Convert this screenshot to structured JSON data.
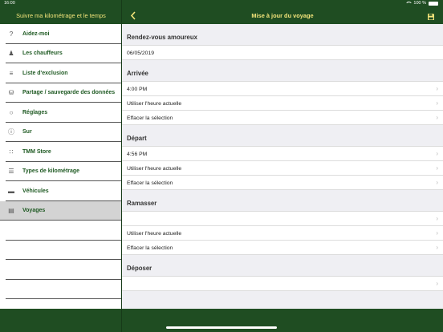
{
  "status": {
    "time": "16:00",
    "battery": "100 %",
    "battery_badge": ""
  },
  "sidebar": {
    "title": "Suivre ma kilométrage et le temps",
    "items": [
      {
        "label": "Aidez-moi",
        "icon": "?"
      },
      {
        "label": "Les chauffeurs",
        "icon": "♟"
      },
      {
        "label": "Liste d'exclusion",
        "icon": "≡"
      },
      {
        "label": "Partage / sauvegarde des données",
        "icon": "⛁"
      },
      {
        "label": "Réglages",
        "icon": "○"
      },
      {
        "label": "Sur",
        "icon": "ⓘ"
      },
      {
        "label": "TMM Store",
        "icon": "∷"
      },
      {
        "label": "Types de kilométrage",
        "icon": "☰"
      },
      {
        "label": "Véhicules",
        "icon": "▬"
      },
      {
        "label": "Voyages",
        "icon": "▤"
      }
    ],
    "active_index": 9
  },
  "header": {
    "title": "Mise à jour du voyage"
  },
  "sections": [
    {
      "title": "Rendez-vous amoureux",
      "rows": [
        {
          "text": "06/05/2019"
        }
      ]
    },
    {
      "title": "Arrivée",
      "rows": [
        {
          "text": "4:00 PM"
        },
        {
          "text": "Utiliser l'heure actuelle"
        },
        {
          "text": "Effacer la sélection"
        }
      ]
    },
    {
      "title": "Départ",
      "rows": [
        {
          "text": "4:56 PM"
        },
        {
          "text": "Utiliser l'heure actuelle"
        },
        {
          "text": "Effacer la sélection"
        }
      ]
    },
    {
      "title": "Ramasser",
      "rows": [
        {
          "text": ""
        },
        {
          "text": "Utiliser l'heure actuelle"
        },
        {
          "text": "Effacer la sélection"
        }
      ]
    },
    {
      "title": "Déposer",
      "rows": [
        {
          "text": ""
        }
      ]
    }
  ],
  "colors": {
    "theme_green": "#1f4d22",
    "title_yellow": "#f3e47a",
    "label_green": "#1f5a23"
  }
}
